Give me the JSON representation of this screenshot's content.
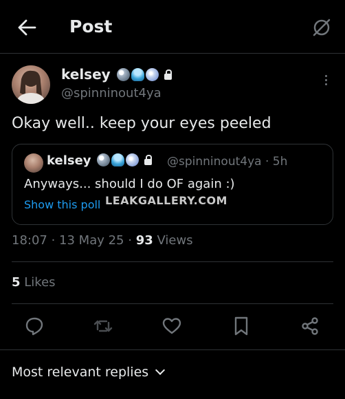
{
  "header": {
    "title": "Post",
    "back_icon": "arrow-left-icon",
    "grok_icon": "grok-icon"
  },
  "post": {
    "name": "kelsey",
    "handle": "@spinninout4ya",
    "text": "Okay well.. keep your eyes peeled",
    "timestamp": "18:07 · 13 May 25 ·",
    "views_count": "93",
    "views_label": "Views"
  },
  "quote": {
    "name": "kelsey",
    "handle_time": "@spinninout4ya · 5h",
    "text": "Anyways... should I do OF again :)",
    "poll_link": "Show this poll",
    "watermark": "LEAKGALLERY.COM"
  },
  "likes": {
    "count": "5",
    "label": "Likes"
  },
  "actions": [
    "reply-icon",
    "repost-icon",
    "like-icon",
    "bookmark-icon",
    "share-icon"
  ],
  "replies_sort": {
    "label": "Most relevant replies"
  },
  "colors": {
    "background": "#000000",
    "text": "#e7e9ea",
    "muted": "#71767b",
    "link": "#1d9bf0",
    "border": "#2f3336"
  }
}
